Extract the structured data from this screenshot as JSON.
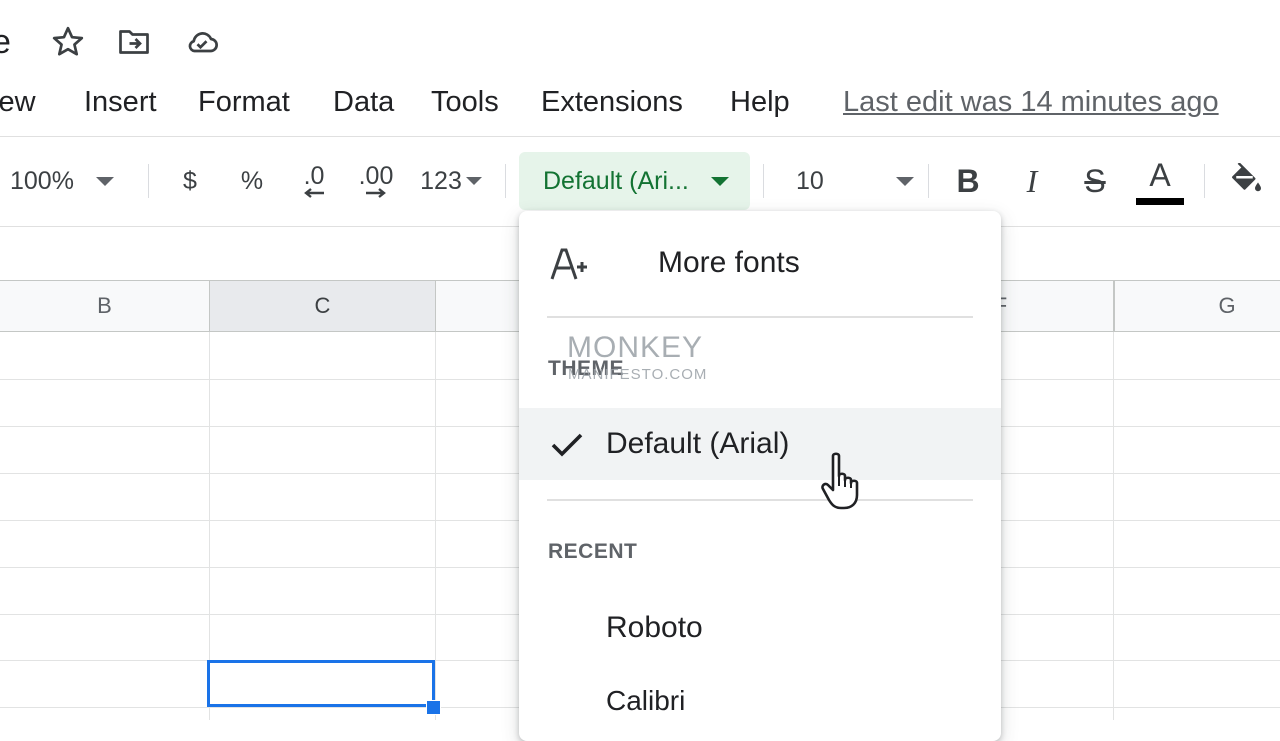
{
  "title": {
    "fragment": "e"
  },
  "title_icons": [
    "star-icon",
    "move-to-folder-icon",
    "cloud-status-icon"
  ],
  "menu": {
    "items": [
      "iew",
      "Insert",
      "Format",
      "Data",
      "Tools",
      "Extensions",
      "Help"
    ],
    "last_edit": "Last edit was 14 minutes ago"
  },
  "toolbar": {
    "zoom": "100%",
    "currency": "$",
    "percent": "%",
    "decrease_decimal": ".0",
    "increase_decimal": ".00",
    "number_format": "123",
    "font": "Default (Ari...",
    "font_size": "10",
    "bold": "B",
    "italic": "I",
    "strikethrough": "S",
    "text_color_glyph": "A"
  },
  "columns": [
    "B",
    "C",
    "",
    "F",
    "G"
  ],
  "dropdown": {
    "more_fonts": "More fonts",
    "theme_label": "THEME",
    "theme_font": "Default (Arial)",
    "recent_label": "RECENT",
    "recent": [
      "Roboto",
      "Calibri"
    ]
  },
  "watermark": {
    "main": "MONKEY",
    "sub": "MANIFESTO.COM"
  },
  "colors": {
    "accent": "#1a73e8",
    "font_select_bg": "#e6f4ea",
    "font_select_text": "#137333"
  }
}
